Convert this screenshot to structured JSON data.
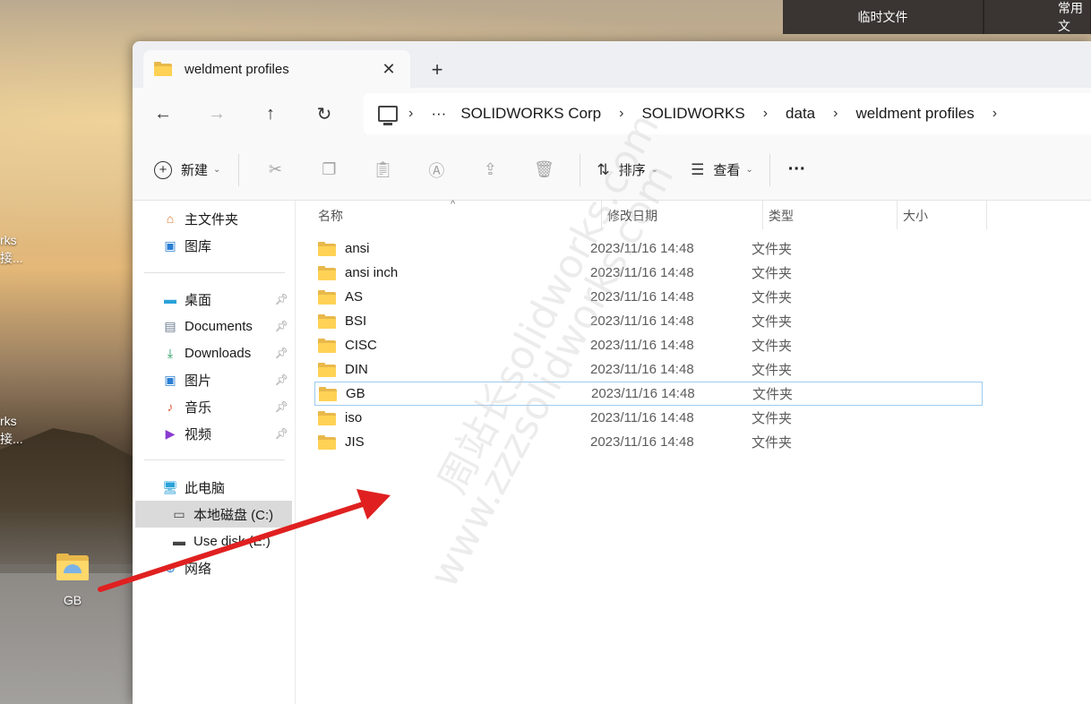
{
  "desktop": {
    "top_tabs": [
      "临时文件",
      "常用文"
    ],
    "side_labels": [
      {
        "line1": "rks",
        "line2": "接..."
      },
      {
        "line1": "rks",
        "line2": "接..."
      }
    ],
    "icon": {
      "label": "GB",
      "name": "folder-icon"
    }
  },
  "window": {
    "tab_title": "weldment profiles",
    "breadcrumb": [
      "SOLIDWORKS Corp",
      "SOLIDWORKS",
      "data",
      "weldment profiles"
    ],
    "breadcrumb_more": "···",
    "toolbar": {
      "new_label": "新建",
      "sort_label": "排序",
      "view_label": "查看",
      "more_label": "···"
    },
    "sidebar": {
      "quick": [
        {
          "label": "主文件夹",
          "icon": "home-icon",
          "color": "#d9772f"
        },
        {
          "label": "图库",
          "icon": "gallery-icon",
          "color": "#2b7fd4"
        }
      ],
      "pinned": [
        {
          "label": "桌面",
          "icon": "desktop-icon",
          "color": "#2aa2d9"
        },
        {
          "label": "Documents",
          "icon": "document-icon",
          "color": "#6b7a8c"
        },
        {
          "label": "Downloads",
          "icon": "download-icon",
          "color": "#1a9a5a"
        },
        {
          "label": "图片",
          "icon": "pictures-icon",
          "color": "#2b7fd4"
        },
        {
          "label": "音乐",
          "icon": "music-icon",
          "color": "#e0603a"
        },
        {
          "label": "视频",
          "icon": "video-icon",
          "color": "#8a3ad0"
        }
      ],
      "devices": [
        {
          "label": "此电脑",
          "icon": "computer-icon",
          "color": "#2aa2d9"
        },
        {
          "label": "本地磁盘 (C:)",
          "icon": "drive-icon",
          "color": "#444"
        },
        {
          "label": "Use disk (E:)",
          "icon": "usb-drive-icon",
          "color": "#444"
        },
        {
          "label": "网络",
          "icon": "network-icon",
          "color": "#2b7fd4"
        }
      ]
    },
    "columns": [
      "名称",
      "修改日期",
      "类型",
      "大小"
    ],
    "files": [
      {
        "name": "ansi",
        "date": "2023/11/16 14:48",
        "type": "文件夹"
      },
      {
        "name": "ansi inch",
        "date": "2023/11/16 14:48",
        "type": "文件夹"
      },
      {
        "name": "AS",
        "date": "2023/11/16 14:48",
        "type": "文件夹"
      },
      {
        "name": "BSI",
        "date": "2023/11/16 14:48",
        "type": "文件夹"
      },
      {
        "name": "CISC",
        "date": "2023/11/16 14:48",
        "type": "文件夹"
      },
      {
        "name": "DIN",
        "date": "2023/11/16 14:48",
        "type": "文件夹"
      },
      {
        "name": "GB",
        "date": "2023/11/16 14:48",
        "type": "文件夹"
      },
      {
        "name": "iso",
        "date": "2023/11/16 14:48",
        "type": "文件夹"
      },
      {
        "name": "JIS",
        "date": "2023/11/16 14:48",
        "type": "文件夹"
      }
    ],
    "selected_file": "GB",
    "selected_nav": "本地磁盘 (C:)"
  },
  "watermark": {
    "line1": "周站长solidworks.com",
    "line2": "www.zzzsolidworks.com"
  },
  "annotation_arrow_color": "#e02020"
}
